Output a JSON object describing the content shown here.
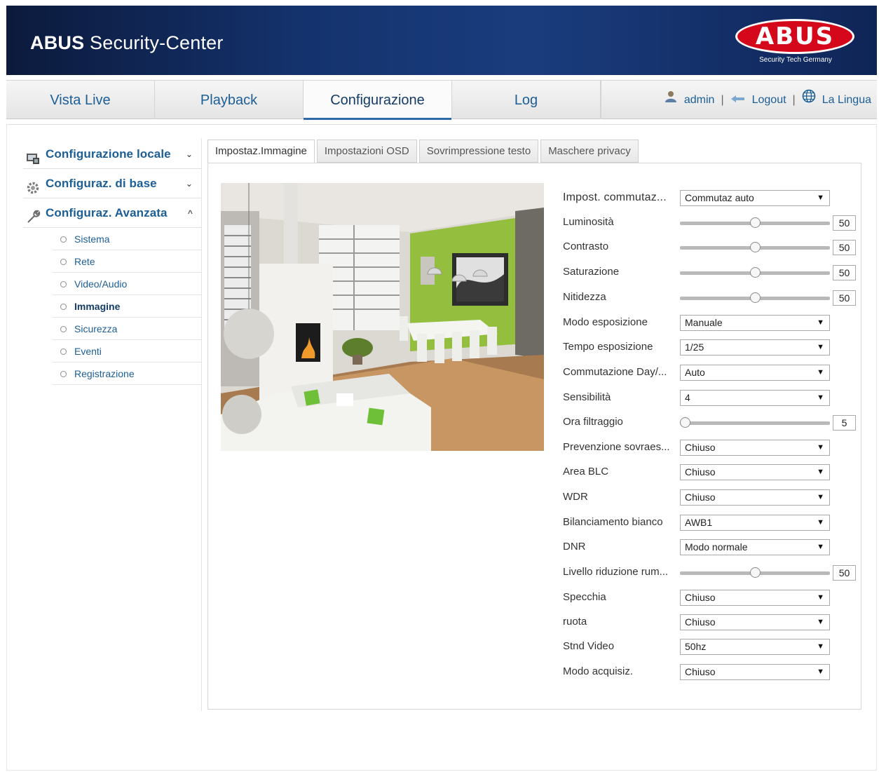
{
  "header": {
    "title_bold": "ABUS",
    "title_rest": " Security-Center",
    "logo_text": "ABUS",
    "logo_tagline": "Security Tech Germany",
    "colors": {
      "bar": "#14336e",
      "logo": "#d5081b"
    }
  },
  "nav": {
    "tabs": [
      "Vista Live",
      "Playback",
      "Configurazione",
      "Log"
    ],
    "active_tab": "Configurazione",
    "user": "admin",
    "separator": "|",
    "logout": "Logout",
    "language": "La Lingua",
    "icons": {
      "user": "user-icon",
      "logout": "logout-icon",
      "language": "globe-icon"
    }
  },
  "sidebar": {
    "sections": [
      {
        "label": "Configurazione locale",
        "icon": "monitor-icon",
        "chevron": "⌄"
      },
      {
        "label": "Configuraz. di base",
        "icon": "gear-icon",
        "chevron": "⌄"
      },
      {
        "label": "Configuraz. Avanzata",
        "icon": "wrench-icon",
        "chevron": "^"
      }
    ],
    "items": [
      "Sistema",
      "Rete",
      "Video/Audio",
      "Immagine",
      "Sicurezza",
      "Eventi",
      "Registrazione"
    ],
    "active_item": "Immagine"
  },
  "subtabs": [
    "Impostaz.Immagine",
    "Impostazioni OSD",
    "Sovrimpressione testo",
    "Maschere privacy"
  ],
  "settings": {
    "switch_label": "Impost. commutaz...",
    "switch_value": "Commutaz auto",
    "brightness_label": "Luminosità",
    "brightness_value": "50",
    "contrast_label": "Contrasto",
    "contrast_value": "50",
    "saturation_label": "Saturazione",
    "saturation_value": "50",
    "sharpness_label": "Nitidezza",
    "sharpness_value": "50",
    "exposure_mode_label": "Modo esposizione",
    "exposure_mode_value": "Manuale",
    "exposure_time_label": "Tempo esposizione",
    "exposure_time_value": "1/25",
    "daynight_label": "Commutazione Day/...",
    "daynight_value": "Auto",
    "sensitivity_label": "Sensibilità",
    "sensitivity_value": "4",
    "filter_time_label": "Ora filtraggio",
    "filter_time_value": "5",
    "overexposure_label": "Prevenzione sovraes...",
    "overexposure_value": "Chiuso",
    "blc_label": "Area BLC",
    "blc_value": "Chiuso",
    "wdr_label": "WDR",
    "wdr_value": "Chiuso",
    "wb_label": "Bilanciamento bianco",
    "wb_value": "AWB1",
    "dnr_label": "DNR",
    "dnr_value": "Modo normale",
    "noise_label": "Livello riduzione rum...",
    "noise_value": "50",
    "mirror_label": "Specchia",
    "mirror_value": "Chiuso",
    "rotate_label": "ruota",
    "rotate_value": "Chiuso",
    "video_std_label": "Stnd Video",
    "video_std_value": "50hz",
    "capture_label": "Modo acquisiz.",
    "capture_value": "Chiuso",
    "dropdown_arrow": "▼",
    "slider_levels": {
      "brightness": 0.5,
      "contrast": 0.5,
      "saturation": 0.5,
      "sharpness": 0.5,
      "filter_time": 0.0,
      "noise": 0.5
    }
  }
}
